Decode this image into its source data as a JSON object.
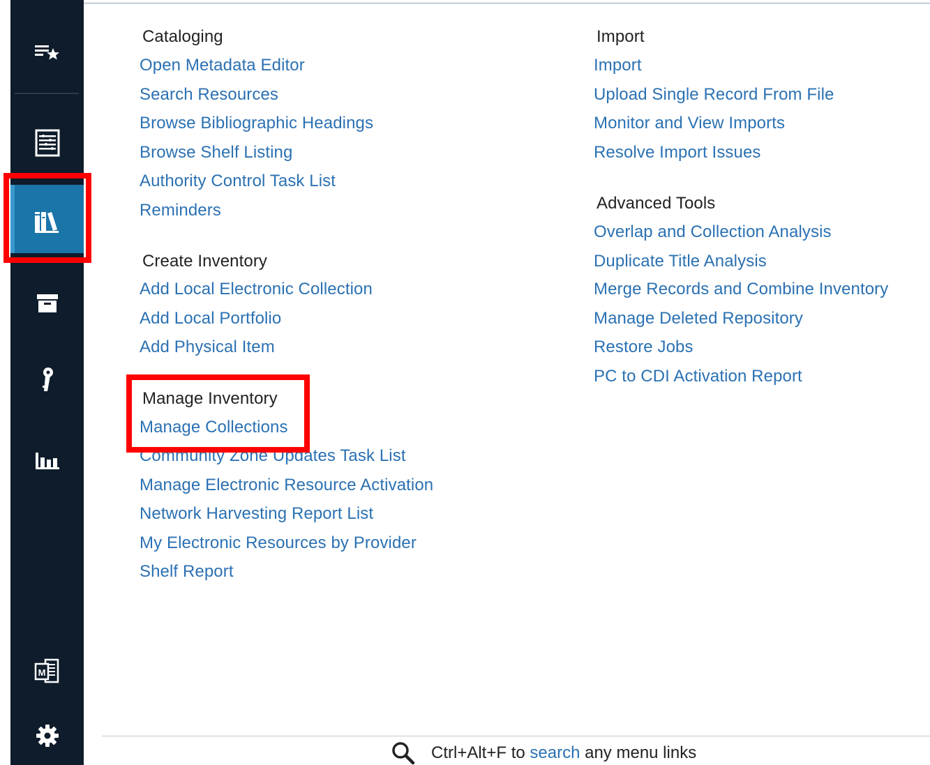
{
  "sidebar": {
    "icons": [
      {
        "name": "favorites-icon"
      },
      {
        "name": "acquisitions-icon"
      },
      {
        "name": "resources-icon"
      },
      {
        "name": "fulfillment-icon"
      },
      {
        "name": "admin-icon"
      },
      {
        "name": "analytics-icon"
      },
      {
        "name": "metadata-editor-icon"
      },
      {
        "name": "settings-icon"
      }
    ],
    "active": "resources-icon"
  },
  "menu": {
    "cataloging": {
      "title": "Cataloging",
      "links": [
        "Open Metadata Editor",
        "Search Resources",
        "Browse Bibliographic Headings",
        "Browse Shelf Listing",
        "Authority Control Task List",
        "Reminders"
      ]
    },
    "create_inventory": {
      "title": "Create Inventory",
      "links": [
        "Add Local Electronic Collection",
        "Add Local Portfolio",
        "Add Physical Item"
      ]
    },
    "manage_inventory": {
      "title": "Manage Inventory",
      "links": [
        "Manage Collections",
        "Community Zone Updates Task List",
        "Manage Electronic Resource Activation",
        "Network Harvesting Report List",
        "My Electronic Resources by Provider",
        "Shelf Report"
      ]
    },
    "import": {
      "title": "Import",
      "links": [
        "Import",
        "Upload Single Record From File",
        "Monitor and View Imports",
        "Resolve Import Issues"
      ]
    },
    "advanced_tools": {
      "title": "Advanced Tools",
      "links": [
        "Overlap and Collection Analysis",
        "Duplicate Title Analysis",
        "Merge Records and Combine Inventory",
        "Manage Deleted Repository",
        "Restore Jobs",
        "PC to CDI Activation Report"
      ]
    }
  },
  "search_hint": {
    "prefix": "Ctrl+Alt+F to",
    "keyword": "search",
    "suffix": "any menu links"
  },
  "colors": {
    "sidebar_bg": "#0e1c2b",
    "active_bg": "#1a75a8",
    "link": "#2b71b3",
    "highlight": "#ff0000"
  }
}
